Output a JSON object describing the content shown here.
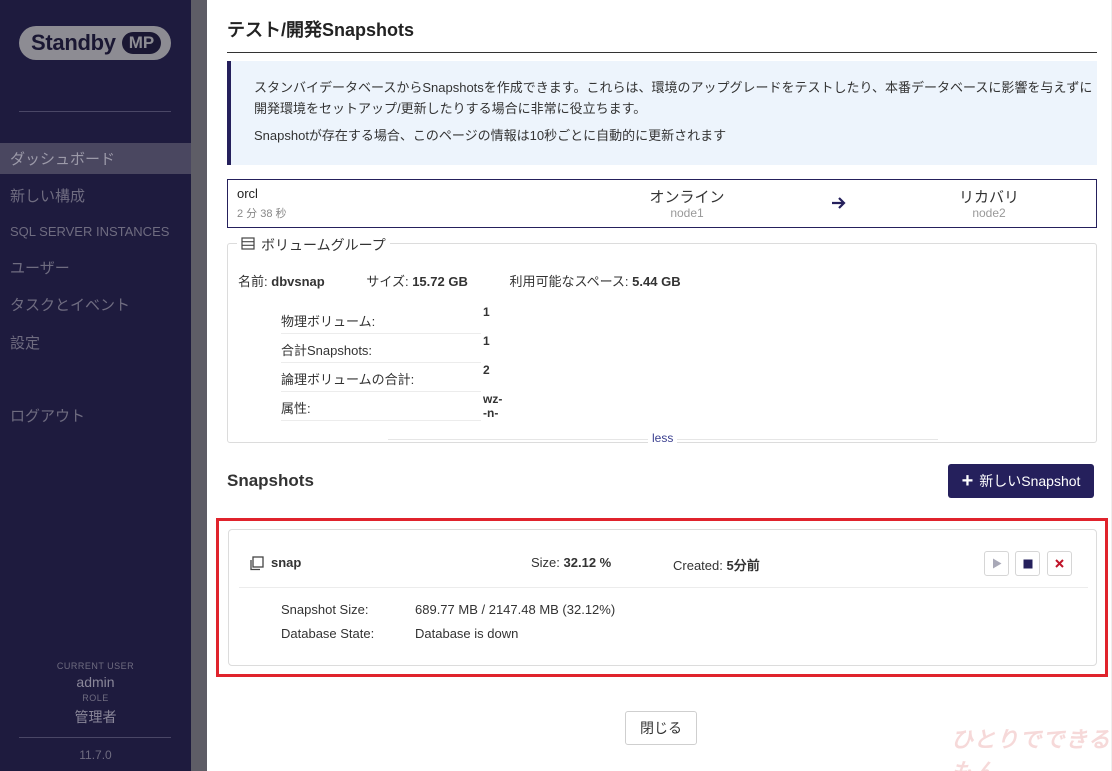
{
  "sidebar": {
    "logo": {
      "text": "Standby",
      "badge": "MP"
    },
    "items": [
      {
        "label": "ダッシュボード",
        "active": true
      },
      {
        "label": "新しい構成"
      },
      {
        "label": "SQL SERVER INSTANCES"
      },
      {
        "label": "ユーザー"
      },
      {
        "label": "タスクとイベント"
      },
      {
        "label": "設定"
      },
      {
        "label": "ログアウト"
      }
    ],
    "user": {
      "current_user_label": "CURRENT USER",
      "current_user": "admin",
      "role_label": "ROLE",
      "role": "管理者"
    },
    "version": "11.7.0"
  },
  "modal": {
    "title": "テスト/開発Snapshots",
    "info": [
      "スタンバイデータベースからSnapshotsを作成できます。これらは、環境のアップグレードをテストしたり、本番データベースに影響を与えずに開発環境をセットアップ/更新したりする場合に非常に役立ちます。",
      "Snapshotが存在する場合、このページの情報は10秒ごとに自動的に更新されます"
    ],
    "node_status": {
      "db_name": "orcl",
      "elapsed": "2 分 38 秒",
      "primary_status": "オンライン",
      "primary_node": "node1",
      "standby_status": "リカバリ",
      "standby_node": "node2"
    },
    "volume_group": {
      "legend": "ボリュームグループ",
      "name_label": "名前:",
      "name": "dbvsnap",
      "size_label": "サイズ:",
      "size": "15.72 GB",
      "free_label": "利用可能なスペース:",
      "free": "5.44 GB",
      "rows": [
        {
          "label": "物理ボリューム:",
          "value": "1"
        },
        {
          "label": "合計Snapshots:",
          "value": "1"
        },
        {
          "label": "論理ボリュームの合計:",
          "value": "2"
        },
        {
          "label": "属性:",
          "value": "wz--n-"
        }
      ],
      "less_link": "less"
    },
    "snapshots": {
      "heading": "Snapshots",
      "new_button": "新しいSnapshot",
      "items": [
        {
          "name": "snap",
          "size_label": "Size:",
          "size": "32.12 %",
          "created_label": "Created:",
          "created": "5分前",
          "details": [
            {
              "label": "Snapshot Size:",
              "value": "689.77 MB / 2147.48 MB (32.12%)"
            },
            {
              "label": "Database State:",
              "value": "Database is down"
            }
          ]
        }
      ]
    },
    "close_button": "閉じる"
  },
  "watermark": "ひとりでできるもん",
  "colors": {
    "primary": "#25205c",
    "sidebar_bg": "#1e1b3e",
    "highlight": "#e0232c",
    "info_bg": "#edf4fc"
  }
}
